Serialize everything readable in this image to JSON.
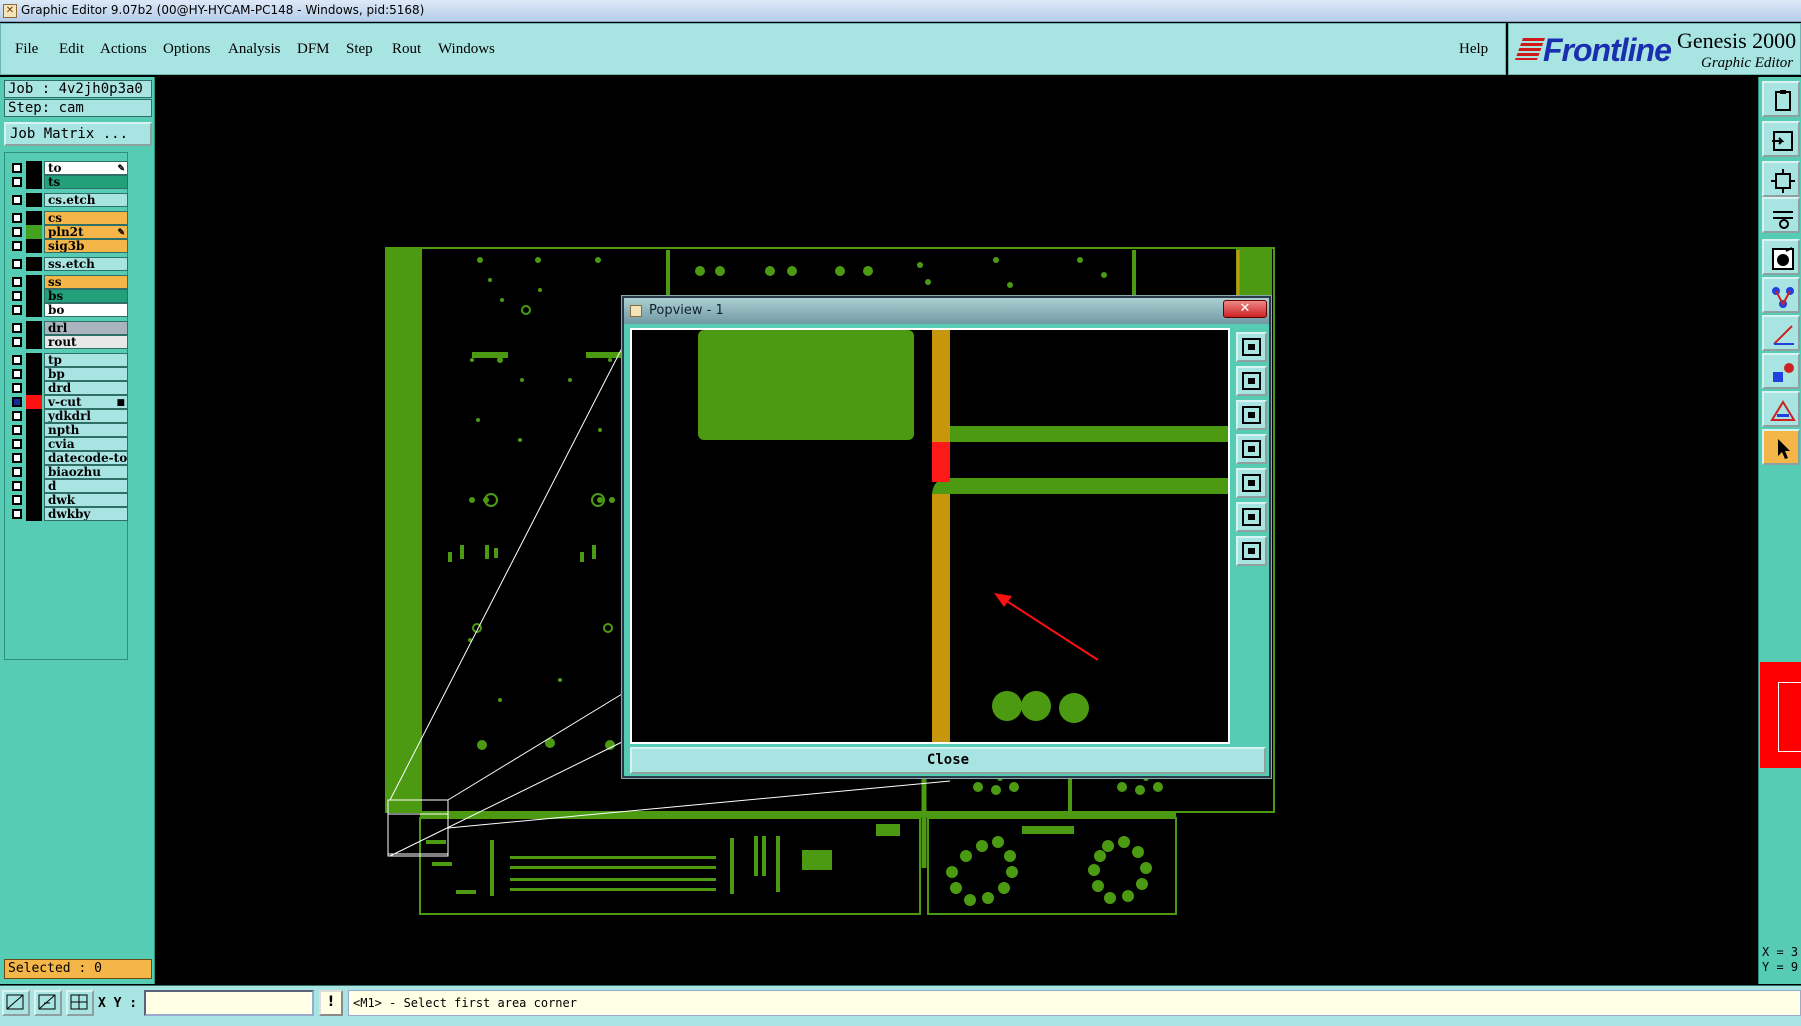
{
  "window": {
    "title": "Graphic Editor 9.07b2 (00@HY-HYCAM-PC148 - Windows, pid:5168)"
  },
  "menu": {
    "items": [
      "File",
      "Edit",
      "Actions",
      "Options",
      "Analysis",
      "DFM",
      "Step",
      "Rout",
      "Windows"
    ],
    "help": "Help"
  },
  "logo": {
    "brand": "Frontline",
    "product": "Genesis 2000",
    "subtitle": "Graphic Editor"
  },
  "job": {
    "job_line": "Job : 4v2jh0p3a0",
    "step_line": "Step: cam",
    "matrix_button": "Job Matrix ..."
  },
  "layers": [
    {
      "name": "to",
      "bg": "#ffffff",
      "swatch": "#000000",
      "mark": "✎"
    },
    {
      "name": "ts",
      "bg": "#22a07a",
      "swatch": "#000000"
    },
    {
      "name": "cs.etch",
      "bg": "#a8e4e2",
      "swatch": "#000000"
    },
    {
      "name": "cs",
      "bg": "#f4b648",
      "swatch": "#000000"
    },
    {
      "name": "pln2t",
      "bg": "#f4b648",
      "swatch": "#44a020",
      "mark": "✎"
    },
    {
      "name": "sig3b",
      "bg": "#f4b648",
      "swatch": "#000000"
    },
    {
      "name": "ss.etch",
      "bg": "#a8e4e2",
      "swatch": "#000000"
    },
    {
      "name": "ss",
      "bg": "#f4b648",
      "swatch": "#000000"
    },
    {
      "name": "bs",
      "bg": "#22a07a",
      "swatch": "#000000"
    },
    {
      "name": "bo",
      "bg": "#ffffff",
      "swatch": "#000000"
    },
    {
      "name": "drl",
      "bg": "#a9b4be",
      "swatch": "#000000"
    },
    {
      "name": "rout",
      "bg": "#e8e8e8",
      "swatch": "#000000"
    },
    {
      "name": "tp",
      "bg": "#a8e4e2",
      "swatch": "#000000"
    },
    {
      "name": "bp",
      "bg": "#a8e4e2",
      "swatch": "#000000"
    },
    {
      "name": "drd",
      "bg": "#a8e4e2",
      "swatch": "#000000"
    },
    {
      "name": "v-cut",
      "bg": "#a8e4e2",
      "swatch": "#ff1010",
      "checked": true,
      "mark": "■"
    },
    {
      "name": "ydkdrl",
      "bg": "#a8e4e2",
      "swatch": "#000000"
    },
    {
      "name": "npth",
      "bg": "#a8e4e2",
      "swatch": "#000000"
    },
    {
      "name": "cvia",
      "bg": "#a8e4e2",
      "swatch": "#000000"
    },
    {
      "name": "datecode-to",
      "bg": "#a8e4e2",
      "swatch": "#000000"
    },
    {
      "name": "biaozhu",
      "bg": "#a8e4e2",
      "swatch": "#000000"
    },
    {
      "name": "d",
      "bg": "#a8e4e2",
      "swatch": "#000000"
    },
    {
      "name": "dwk",
      "bg": "#a8e4e2",
      "swatch": "#000000"
    },
    {
      "name": "dwkby",
      "bg": "#a8e4e2",
      "swatch": "#000000"
    }
  ],
  "status": {
    "selected": "Selected : 0",
    "xy_label": "X Y :",
    "xy_value": "",
    "warn": "!",
    "prompt": "<M1> - Select first area corner"
  },
  "coords": {
    "x": "X = 3",
    "y": "Y = 9"
  },
  "popview": {
    "title": "Popview - 1",
    "close_x": "✕",
    "close_button": "Close"
  },
  "colors": {
    "panel": "#56ccb4",
    "light": "#a8e4e2",
    "copper": "#4c9a12",
    "trace_orange": "#c8960c",
    "highlight_red": "#ff1a1a"
  },
  "right_tools": [
    "clipboard-icon",
    "step-in-icon",
    "zoom-fit-icon",
    "snap-settings-icon",
    "display-icon",
    "nets-icon",
    "measure-icon",
    "features-icon",
    "drc-icon",
    "pointer-icon"
  ],
  "pop_tools": [
    "pop-zoom-icon",
    "pop-up-icon",
    "pop-down-icon",
    "pop-left-icon",
    "pop-right-icon",
    "pop-fit-icon",
    "pop-center-icon"
  ]
}
